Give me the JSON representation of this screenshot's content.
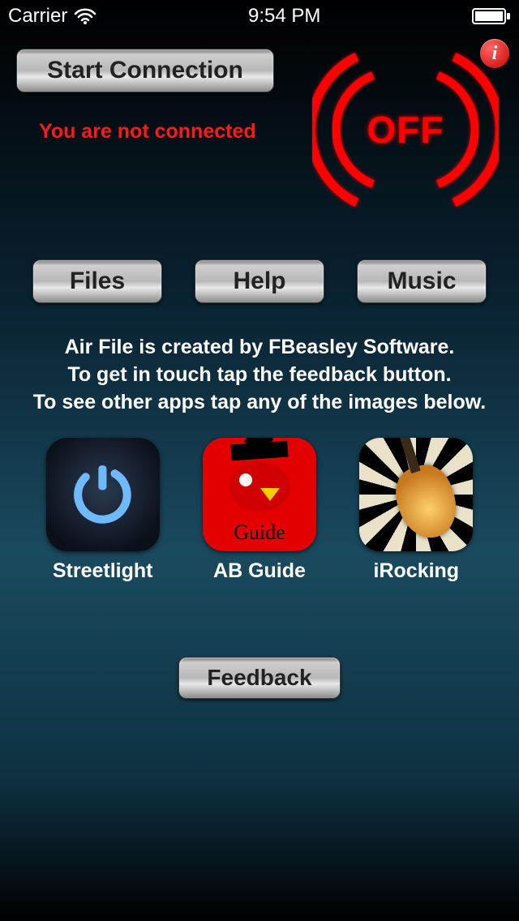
{
  "status_bar": {
    "carrier": "Carrier",
    "time": "9:54 PM"
  },
  "connection": {
    "start_label": "Start Connection",
    "status_text": "You are not connected",
    "power_state": "OFF"
  },
  "info_badge": "i",
  "nav": {
    "files": "Files",
    "help": "Help",
    "music": "Music"
  },
  "description": {
    "line1": "Air File is created by FBeasley Software.",
    "line2": "To get in touch tap the feedback button.",
    "line3": "To see other apps tap any of the images below."
  },
  "apps": {
    "streetlight": {
      "label": "Streetlight"
    },
    "abguide": {
      "label": "AB Guide",
      "icon_text": "Guide"
    },
    "irocking": {
      "label": "iRocking"
    }
  },
  "feedback": {
    "label": "Feedback"
  },
  "colors": {
    "accent_red": "#ff0000",
    "status_red": "#ff1a1a"
  }
}
